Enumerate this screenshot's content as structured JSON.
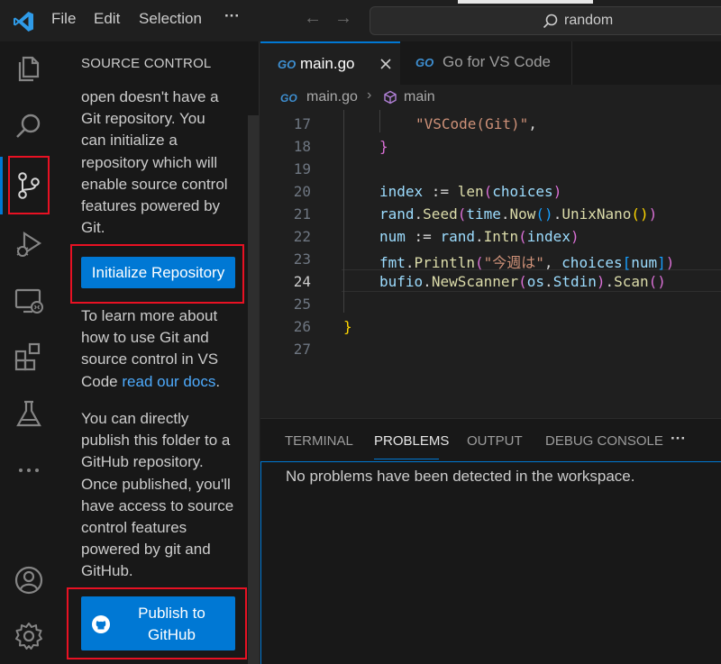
{
  "titlebar": {
    "menu": [
      "File",
      "Edit",
      "Selection",
      "···"
    ],
    "search_text": "random"
  },
  "activitybar": {
    "icons": [
      "explorer-icon",
      "search-icon",
      "source-control-icon",
      "run-debug-icon",
      "remote-explorer-icon",
      "extensions-icon",
      "testing-icon",
      "more-icon",
      "account-icon",
      "settings-gear-icon"
    ]
  },
  "sidebar": {
    "header": "SOURCE CONTROL",
    "intro_lines": [
      "open doesn't have a",
      "Git repository. You",
      "can initialize a",
      "repository which will",
      "enable source control",
      "features powered by",
      "Git."
    ],
    "init_button": "Initialize Repository",
    "learn_lines": [
      "To learn more about",
      "how to use Git and",
      "source control in VS"
    ],
    "learn_last_prefix": "Code ",
    "learn_link": "read our docs",
    "learn_last_suffix": ".",
    "publish_lines": [
      "You can directly",
      "publish this folder to a",
      "GitHub repository.",
      "Once published, you'll",
      "have access to source",
      "control features",
      "powered by git and",
      "GitHub."
    ],
    "publish_button_line1": "Publish to",
    "publish_button_line2": "GitHub"
  },
  "tabs": {
    "go_badge": "GO",
    "items": [
      {
        "label": "main.go",
        "active": true
      },
      {
        "label": "Go for VS Code",
        "active": false
      }
    ]
  },
  "breadcrumb": {
    "file": "main.go",
    "symbol": "main"
  },
  "editor": {
    "line_numbers": [
      "17",
      "18",
      "19",
      "20",
      "21",
      "22",
      "23",
      "24",
      "25",
      "26",
      "27"
    ],
    "current_line": "24"
  },
  "panel": {
    "tabs": [
      "TERMINAL",
      "PROBLEMS",
      "OUTPUT",
      "DEBUG CONSOLE",
      "···"
    ],
    "active_tab": "PROBLEMS",
    "message": "No problems have been detected in the workspace."
  }
}
